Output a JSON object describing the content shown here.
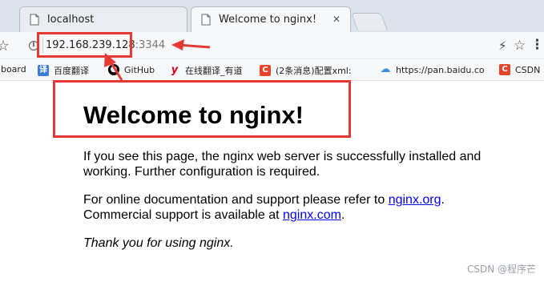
{
  "tabs": [
    {
      "title": "localhost",
      "active": false
    },
    {
      "title": "Welcome to nginx!",
      "active": true
    }
  ],
  "address_bar": {
    "url_main": "192.168.239.128",
    "url_port": ":3344"
  },
  "bookmarks": [
    {
      "label": "hboard",
      "icon": "dashboard-icon"
    },
    {
      "label": "百度翻译",
      "icon": "fanyi-icon"
    },
    {
      "label": "GitHub",
      "icon": "github-icon"
    },
    {
      "label": "在线翻译_有道",
      "icon": "youdao-icon"
    },
    {
      "label": "(2条消息)配置xml:",
      "icon": "csdn-icon"
    },
    {
      "label": "https://pan.baidu.co",
      "icon": "baidu-pan-icon"
    },
    {
      "label": "CSDN",
      "icon": "csdn-icon"
    }
  ],
  "page": {
    "heading": "Welcome to nginx!",
    "p1": "If you see this page, the nginx web server is successfully installed and working. Further configuration is required.",
    "p2_prefix": "For online documentation and support please refer to ",
    "p2_link1": "nginx.org",
    "p2_middle": ".",
    "p2_line2_prefix": "Commercial support is available at ",
    "p2_link2": "nginx.com",
    "p2_suffix": ".",
    "p3": "Thank you for using nginx."
  },
  "watermark": "CSDN @程序芒",
  "colors": {
    "annotation": "#e53935",
    "link": "#0000ee"
  }
}
